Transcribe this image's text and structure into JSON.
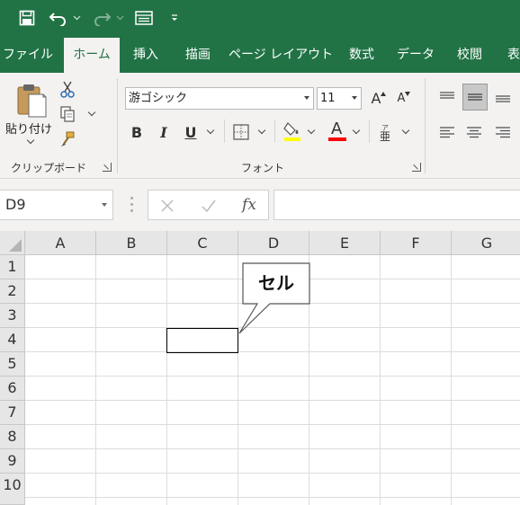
{
  "tabs": [
    {
      "label": "ファイル",
      "active": false
    },
    {
      "label": "ホーム",
      "active": true
    },
    {
      "label": "挿入",
      "active": false
    },
    {
      "label": "描画",
      "active": false
    },
    {
      "label": "ページ レイアウト",
      "active": false
    },
    {
      "label": "数式",
      "active": false
    },
    {
      "label": "データ",
      "active": false
    },
    {
      "label": "校閲",
      "active": false
    },
    {
      "label": "表",
      "active": false
    }
  ],
  "clipboard": {
    "paste_label": "貼り付け",
    "group_label": "クリップボード"
  },
  "font": {
    "font_name": "游ゴシック",
    "font_size": "11",
    "bold_label": "B",
    "italic_label": "I",
    "underline_label": "U",
    "font_color_label": "A",
    "grow_label": "A",
    "shrink_label": "A",
    "group_label": "フォント",
    "highlight_color": "#ffff00",
    "font_color": "#ff0000"
  },
  "formula_bar": {
    "name_box": "D9",
    "fx_label": "fx",
    "formula_value": ""
  },
  "grid": {
    "columns": [
      "A",
      "B",
      "C",
      "D",
      "E",
      "F",
      "G"
    ],
    "rows": [
      "1",
      "2",
      "3",
      "4",
      "5",
      "6",
      "7",
      "8",
      "9",
      "10"
    ]
  },
  "callout": {
    "text": "セル"
  },
  "colors": {
    "excel_green": "#217346",
    "ribbon_bg": "#f3f2f1"
  }
}
